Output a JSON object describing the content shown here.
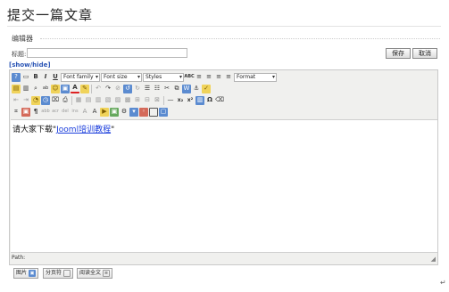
{
  "page": {
    "title": "提交一篇文章"
  },
  "editor_section": {
    "legend": "编辑器"
  },
  "form": {
    "title_label": "标题:",
    "title_value": "",
    "save_label": "保存",
    "cancel_label": "取消",
    "toggle_label": "[show/hide]"
  },
  "toolbar": {
    "row1_icons": [
      "help-icon",
      "new-document-icon",
      "bold-icon",
      "italic-icon",
      "underline-icon"
    ],
    "font_family": "Font family",
    "font_size": "Font size",
    "styles": "Styles",
    "format": "Format",
    "row1_tail_icons": [
      "spellcheck-icon",
      "align-left-icon",
      "align-center-icon",
      "align-right-icon",
      "align-justify-icon"
    ],
    "row2_icons": [
      "paste-icon",
      "paste-text-icon",
      "find-replace-icon",
      "smiley-icon",
      "text-color-icon",
      "highlight-color-icon",
      "undo-icon",
      "redo-icon",
      "unordered-list-icon",
      "ordered-list-icon",
      "cut-icon",
      "copy-icon",
      "paste-word-icon",
      "anchor-icon",
      "cleanup-icon"
    ],
    "row3_icons": [
      "outdent-icon",
      "indent-icon",
      "insert-date-icon",
      "insert-time-icon",
      "preview-icon",
      "table-icon",
      "row-icon",
      "column-icon",
      "merge-cells-icon",
      "split-cells-icon",
      "delete-row-icon",
      "horizontal-rule-icon",
      "subscript-icon",
      "superscript-icon",
      "visual-aid-icon",
      "special-char-icon",
      "remove-format-icon"
    ],
    "row4_icons": [
      "code-icon",
      "image-icon",
      "paragraph-icon",
      "abbr-icon",
      "acronym-icon",
      "del-icon",
      "ins-icon",
      "citation-icon",
      "attribs-icon",
      "media-icon",
      "layer-icon",
      "style-props-icon",
      "non-breaking-icon",
      "fullscreen-icon"
    ]
  },
  "content": {
    "prefix": "请大家下载\"",
    "link_text": "Jooml培训教程",
    "suffix": "\""
  },
  "status": {
    "path_label": "Path:"
  },
  "bottom_buttons": {
    "image": "图片",
    "pagebreak": "分页符",
    "readmore": "阅读全文"
  }
}
